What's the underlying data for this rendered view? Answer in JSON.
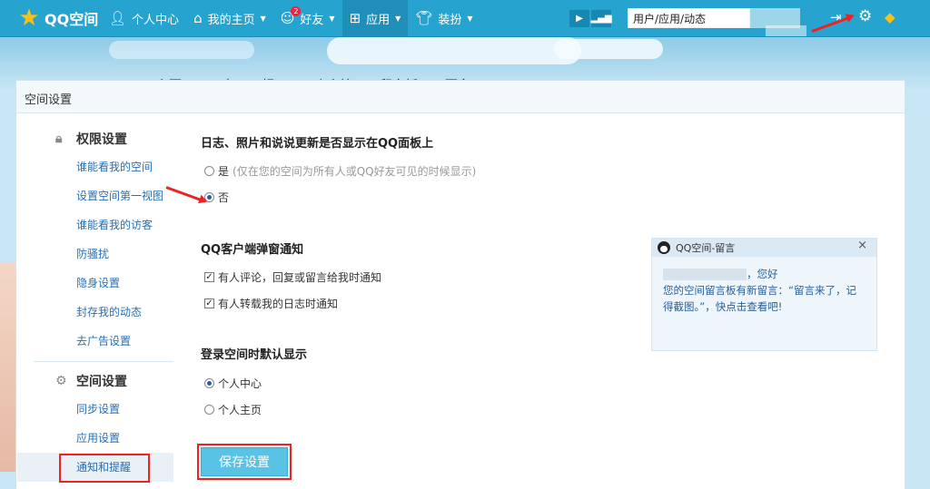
{
  "topbar": {
    "logo_text": "QQ空间",
    "nav": [
      {
        "label": "个人中心",
        "icon": "user-icon"
      },
      {
        "label": "我的主页",
        "icon": "home-icon"
      },
      {
        "label": "好友",
        "icon": "friends-icon",
        "badge": "2"
      },
      {
        "label": "应用",
        "icon": "apps-icon"
      },
      {
        "label": "装扮",
        "icon": "shirt-icon"
      }
    ],
    "search_value": "用户/应用/动态",
    "accent": "#26a4cf"
  },
  "subnav": [
    "主页",
    "日志",
    "相册",
    "个人档",
    "留言板",
    "更多"
  ],
  "panel": {
    "title": "空间设置"
  },
  "sidebar": {
    "sections": [
      {
        "title": "权限设置",
        "icon": "lock-icon",
        "items": [
          "谁能看我的空间",
          "设置空间第一视图",
          "谁能看我的访客",
          "防骚扰",
          "隐身设置",
          "封存我的动态",
          "去广告设置"
        ]
      },
      {
        "title": "空间设置",
        "icon": "gear-icon",
        "items": [
          "同步设置",
          "应用设置",
          "通知和提醒"
        ]
      }
    ]
  },
  "content": {
    "q1": {
      "title": "日志、照片和说说更新是否显示在QQ面板上",
      "yes_label": "是",
      "yes_note": "(仅在您的空间为所有人或QQ好友可见的时候显示)",
      "no_label": "否"
    },
    "q2": {
      "title": "QQ客户端弹窗通知",
      "opt1": "有人评论，回复或留言给我时通知",
      "opt2": "有人转载我的日志时通知"
    },
    "q3": {
      "title": "登录空间时默认显示",
      "opt1": "个人中心",
      "opt2": "个人主页"
    },
    "save_label": "保存设置"
  },
  "popup": {
    "title": "QQ空间-留言",
    "greeting": "，您好",
    "line1": "您的空间留言板有新留言：“留言来了，记",
    "line2": "得截图。”，快点击查看吧!"
  }
}
